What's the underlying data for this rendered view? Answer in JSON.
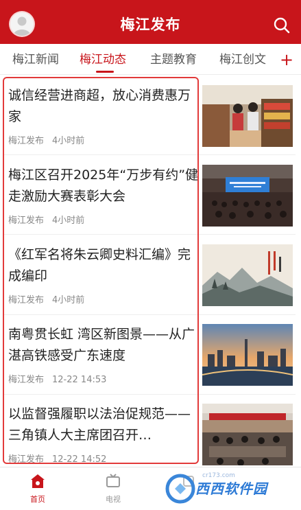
{
  "header": {
    "title": "梅江发布"
  },
  "tabs": [
    {
      "label": "梅江新闻"
    },
    {
      "label": "梅江动态",
      "active": true
    },
    {
      "label": "主题教育"
    },
    {
      "label": "梅江创文"
    }
  ],
  "tabs_more": "+",
  "articles": [
    {
      "title": "诚信经营进商超，放心消费惠万家",
      "source": "梅江发布",
      "time": "4小时前",
      "thumb": "supermarket"
    },
    {
      "title": "梅江区召开2025年“万步有约”健走激励大赛表彰大会",
      "source": "梅江发布",
      "time": "4小时前",
      "thumb": "meeting-hall"
    },
    {
      "title": "《红军名将朱云卿史料汇编》完成编印",
      "source": "梅江发布",
      "time": "4小时前",
      "thumb": "book-cover"
    },
    {
      "title": "南粤贯长虹 湾区新图景——从广湛高铁感受广东速度",
      "source": "梅江发布",
      "time": "12-22 14:53",
      "thumb": "city-skyline"
    },
    {
      "title": "以监督强履职以法治促规范——三角镇人大主席团召开…",
      "source": "梅江发布",
      "time": "12-22 14:52",
      "thumb": "conference"
    }
  ],
  "bottom_nav": [
    {
      "label": "首页",
      "icon": "home-icon",
      "active": true
    },
    {
      "label": "电视",
      "icon": "tv-icon"
    },
    {
      "label": "",
      "icon": "partial-icon"
    }
  ],
  "watermark": {
    "text": "西西软件园",
    "url": "cr173.com"
  },
  "colors": {
    "brand": "#c8151b",
    "highlight": "#e23a3a",
    "meta": "#888888"
  }
}
